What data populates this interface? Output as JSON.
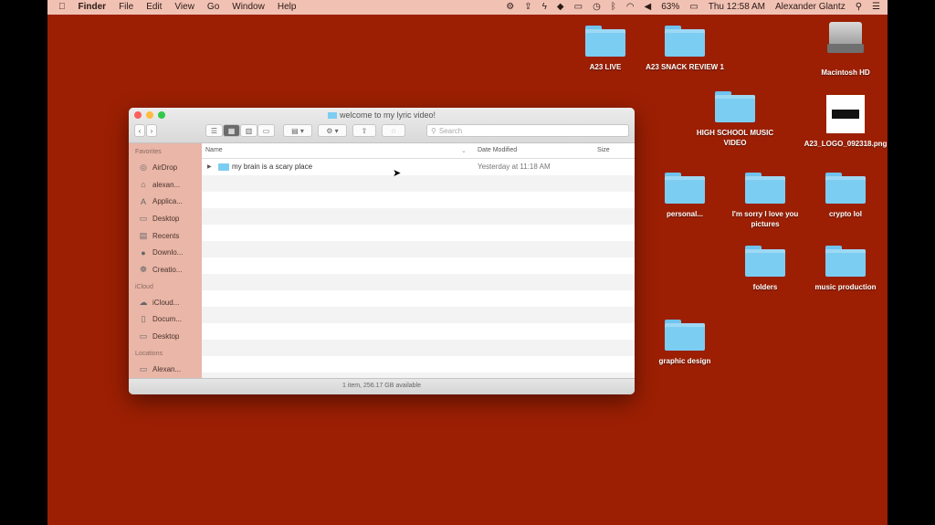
{
  "menubar": {
    "apple": "",
    "app": "Finder",
    "menus": [
      "File",
      "Edit",
      "View",
      "Go",
      "Window",
      "Help"
    ],
    "battery": "63%",
    "clock": "Thu 12:58 AM",
    "user": "Alexander Glantz"
  },
  "desktop": {
    "icons": [
      {
        "label": "A23 LIVE"
      },
      {
        "label": "A23 SNACK REVIEW 1"
      },
      {
        "label": "Macintosh HD"
      },
      {
        "label": "HIGH SCHOOL MUSIC VIDEO"
      },
      {
        "label": "A23_LOGO_092318.png"
      },
      {
        "label": "personal..."
      },
      {
        "label": "I'm sorry I love you pictures"
      },
      {
        "label": "crypto lol"
      },
      {
        "label": "folders"
      },
      {
        "label": "music production"
      },
      {
        "label": "graphic design"
      }
    ]
  },
  "window": {
    "title": "welcome to my lyric video!",
    "search_placeholder": "Search",
    "columns": {
      "name": "Name",
      "date": "Date Modified",
      "size": "Size"
    },
    "rows": [
      {
        "name": "my brain is a scary place",
        "date": "Yesterday at 11:18 AM"
      }
    ],
    "sidebar": {
      "favorites_head": "Favorites",
      "favorites": [
        "AirDrop",
        "alexan...",
        "Applica...",
        "Desktop",
        "Recents",
        "Downlo...",
        "Creatio..."
      ],
      "icloud_head": "iCloud",
      "icloud": [
        "iCloud...",
        "Docum...",
        "Desktop"
      ],
      "locations_head": "Locations",
      "locations": [
        "Alexan..."
      ]
    },
    "status": "1 item, 256.17 GB available"
  },
  "colors": {
    "desktop": "#9c1f03",
    "folder": "#7ccdf2",
    "sidebar": "#e9b6a8",
    "menubar": "#f1c2b4"
  }
}
